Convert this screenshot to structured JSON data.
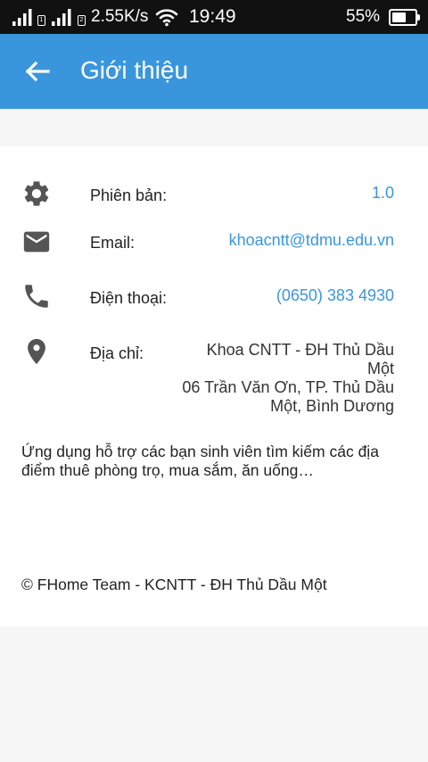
{
  "status_bar": {
    "sim1_label": "1",
    "sim2_label": "2",
    "network_speed": "2.55K/s",
    "time": "19:49",
    "battery_percent": "55%",
    "battery_level": 0.55
  },
  "app_bar": {
    "back_icon": "arrow-left-icon",
    "title": "Giới thiệu",
    "color": "#3a96dc"
  },
  "info": {
    "version": {
      "icon": "gear-icon",
      "label": "Phiên bản:",
      "value": "1.0"
    },
    "email": {
      "icon": "envelope-icon",
      "label": "Email:",
      "value": "khoacntt@tdmu.edu.vn"
    },
    "phone": {
      "icon": "phone-icon",
      "label": "Điện thoại:",
      "value": "(0650) 383 4930"
    },
    "address": {
      "icon": "location-pin-icon",
      "label": "Địa chỉ:",
      "lines": [
        "Khoa CNTT - ĐH Thủ Dầu",
        "Một",
        "06 Trần Văn Ơn, TP. Thủ Dầu",
        "Một, Bình Dương"
      ]
    }
  },
  "description_lines": [
    "Ứng dụng hỗ trợ các bạn sinh viên tìm kiếm các địa",
    "điểm thuê phòng trọ, mua sắm, ăn uống…"
  ],
  "footer": "© FHome Team - KCNTT - ĐH Thủ Dầu Một",
  "colors": {
    "accent": "#3a96dc",
    "icon_gray": "#555555",
    "status_bar": "#111111"
  }
}
